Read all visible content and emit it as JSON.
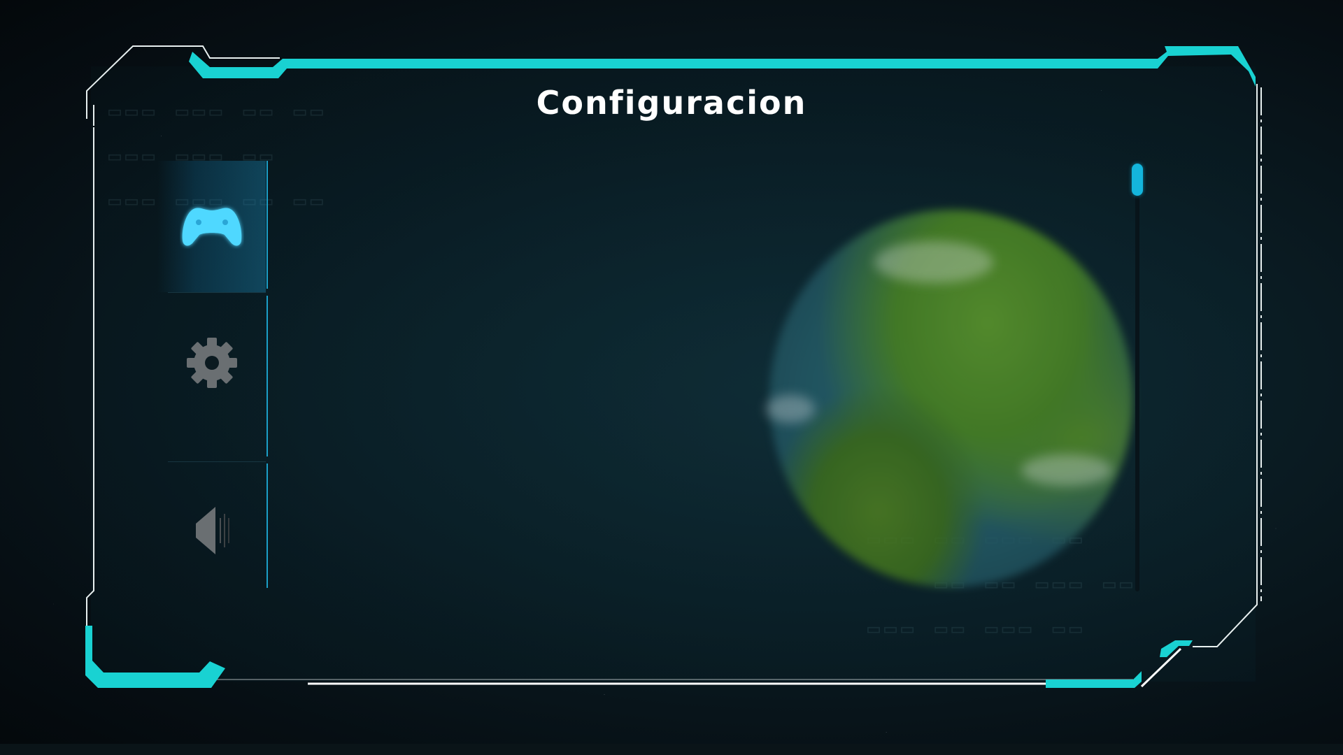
{
  "title": "Configuracion",
  "tabs": [
    {
      "id": "controls",
      "icon": "gamepad-icon",
      "active": true
    },
    {
      "id": "settings",
      "icon": "gear-icon",
      "active": false
    },
    {
      "id": "audio",
      "icon": "speaker-icon",
      "active": false
    }
  ],
  "scrollbar": {
    "position": 0.0
  },
  "colors": {
    "accent": "#19d2d2",
    "active_icon": "#4fd8ff",
    "inactive_icon": "#6a6f72",
    "tab_line": "#1b9fc8",
    "title": "#ffffff"
  }
}
